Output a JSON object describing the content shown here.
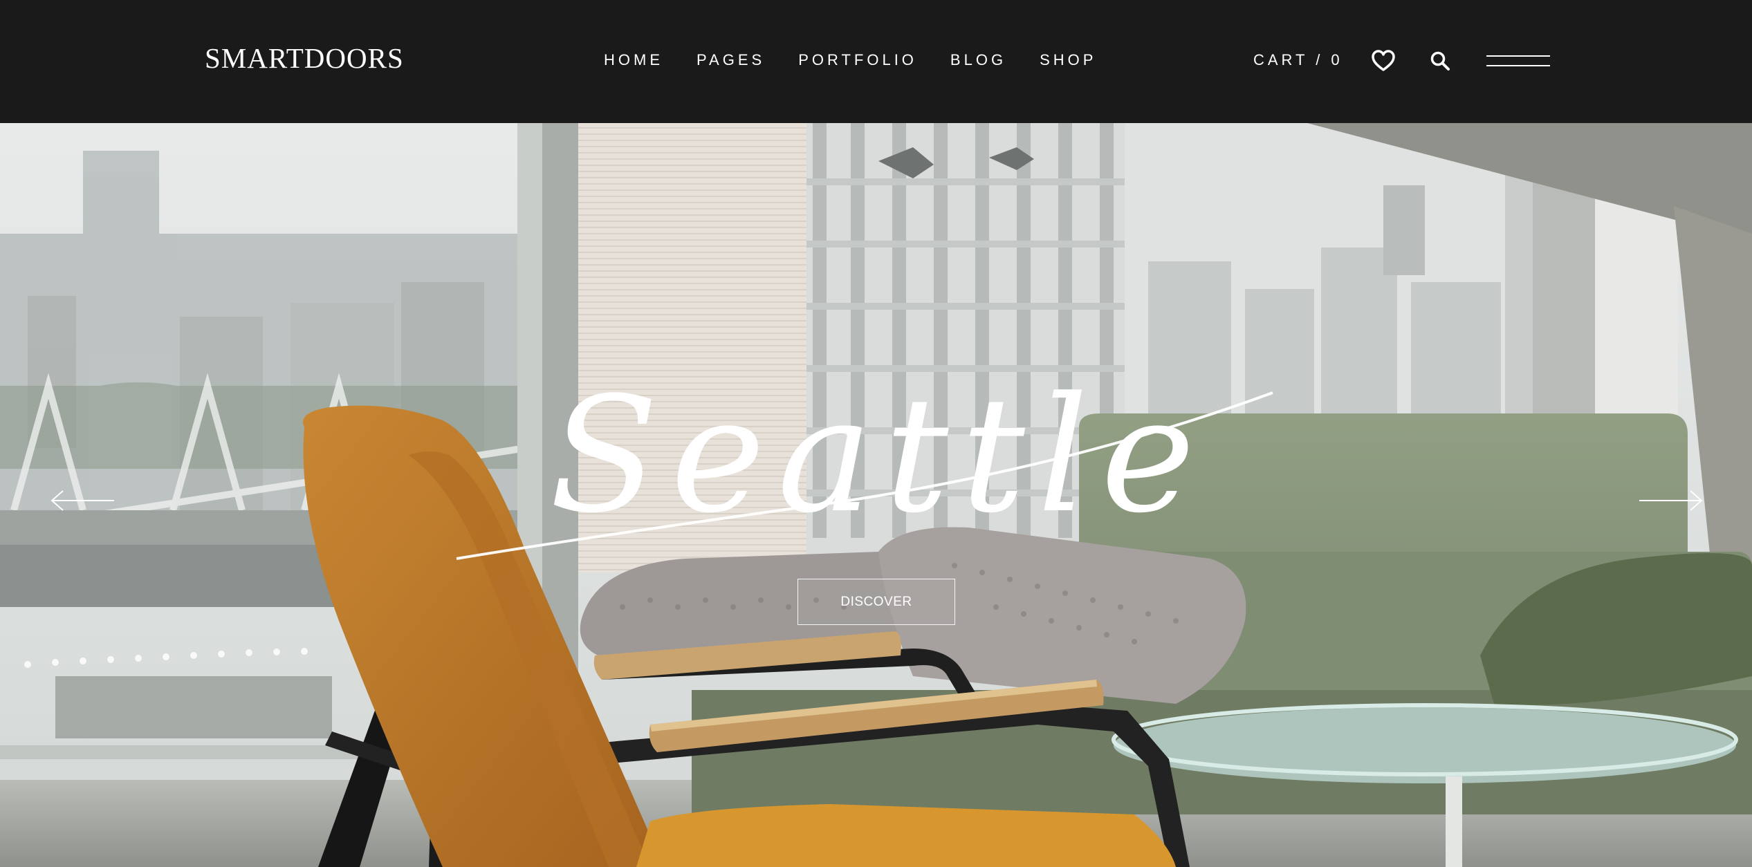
{
  "header": {
    "logo": "SMARTDOORS",
    "nav": [
      "HOME",
      "PAGES",
      "PORTFOLIO",
      "BLOG",
      "SHOP"
    ],
    "cart_label": "CART / 0",
    "icons": [
      "heart-icon",
      "search-icon",
      "menu-icon"
    ]
  },
  "hero": {
    "title": "Seattle",
    "button_label": "DISCOVER",
    "prev_icon": "arrow-left-icon",
    "next_icon": "arrow-right-icon"
  },
  "colors": {
    "header_bg": "#1a1a1a",
    "text": "#ffffff",
    "chair": "#c27a2c",
    "sofa": "#8c9a7c"
  }
}
